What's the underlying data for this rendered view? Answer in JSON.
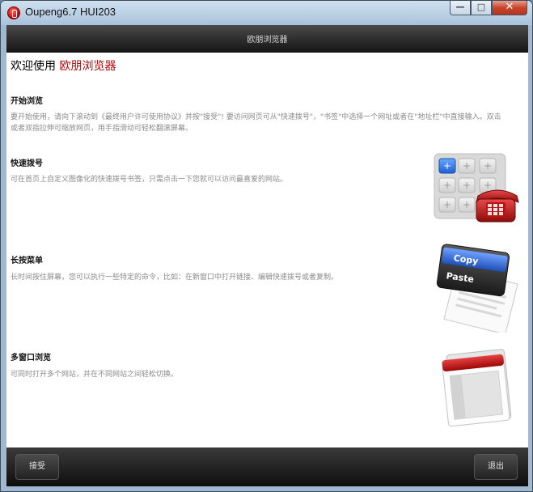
{
  "window": {
    "title": "Oupeng6.7 HUI203"
  },
  "topbar": {
    "title": "欧朋浏览器"
  },
  "welcome": {
    "prefix": "欢迎使用",
    "brand": "欧朋浏览器"
  },
  "sections": [
    {
      "title": "开始浏览",
      "desc": "要开始使用，请向下滚动到《最终用户许可使用协议》并按\"接受\"! 要访问网页可从\"快速拨号\"，\"书签\"中选择一个网址或者在\"地址栏\"中直接输入。双击或者双指拉伸可缩放网页，用手指滑动可轻松翻滚屏幕。"
    },
    {
      "title": "快速拨号",
      "desc": "可在首页上自定义图像化的快速拨号书签，只需点击一下您就可以访问最喜爱的网站。"
    },
    {
      "title": "长按菜单",
      "desc": "长时间按住屏幕，您可以执行一些特定的命令，比如：在新窗口中打开链接、编辑快速拨号或者复制。"
    },
    {
      "title": "多窗口浏览",
      "desc": "可同时打开多个网站，并在不同网站之间轻松切换。"
    }
  ],
  "illustrations": {
    "copy_label": "Copy",
    "paste_label": "Paste"
  },
  "buttons": {
    "accept": "接受",
    "exit": "退出"
  },
  "colors": {
    "brand_red": "#c00000"
  }
}
